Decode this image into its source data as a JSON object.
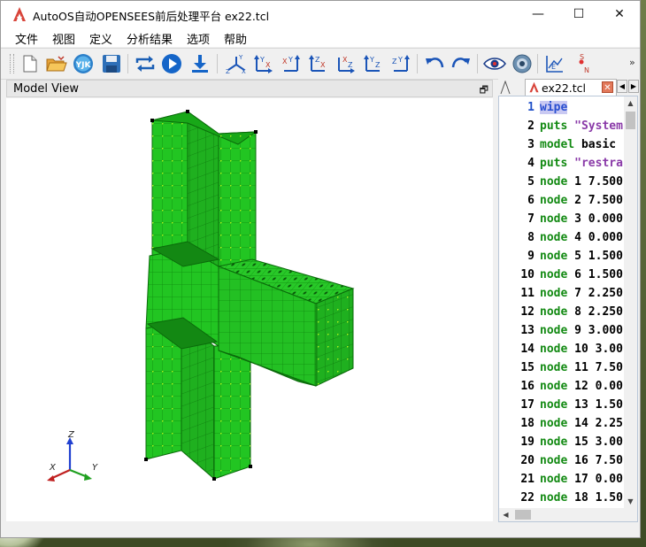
{
  "window": {
    "title": "AutoOS自动OPENSEES前后处理平台 ex22.tcl",
    "minimize": "—",
    "maximize": "☐",
    "close": "✕"
  },
  "menu": [
    "文件",
    "视图",
    "定义",
    "分析结果",
    "选项",
    "帮助"
  ],
  "toolbar": {
    "buttons": [
      "new-file-icon",
      "open-folder-icon",
      "yjk-import-icon",
      "save-icon",
      "refresh-icon",
      "run-icon",
      "download-icon",
      "view-3d-icon",
      "view-xy-icon",
      "view-yx-icon",
      "view-xz-icon",
      "view-zx-icon",
      "view-yz-icon",
      "view-zy-icon",
      "undo-icon",
      "redo-icon",
      "eye-icon",
      "camera-icon",
      "edit-chart-icon",
      "section-sn-icon"
    ],
    "yjk_label": "YJK",
    "more": "»"
  },
  "model_view": {
    "title": "Model View",
    "restore": "🗗",
    "axes": {
      "z": "Z",
      "x": "X",
      "y": "Y"
    }
  },
  "editor": {
    "tab_label": "ex22.tcl",
    "close": "✕",
    "nav_left": "◀",
    "nav_right": "▶",
    "lines": [
      {
        "n": "1",
        "kw": "wipe",
        "rest": ""
      },
      {
        "n": "2",
        "kw": "puts",
        "rest": " \"System"
      },
      {
        "n": "3",
        "kw": "model",
        "rest": " basic"
      },
      {
        "n": "4",
        "kw": "puts",
        "rest": " \"restra"
      },
      {
        "n": "5",
        "kw": "node",
        "rest": " 1 7.500"
      },
      {
        "n": "6",
        "kw": "node",
        "rest": " 2 7.500"
      },
      {
        "n": "7",
        "kw": "node",
        "rest": " 3 0.000"
      },
      {
        "n": "8",
        "kw": "node",
        "rest": " 4 0.000"
      },
      {
        "n": "9",
        "kw": "node",
        "rest": " 5 1.500"
      },
      {
        "n": "10",
        "kw": "node",
        "rest": " 6 1.500"
      },
      {
        "n": "11",
        "kw": "node",
        "rest": " 7 2.250"
      },
      {
        "n": "12",
        "kw": "node",
        "rest": " 8 2.250"
      },
      {
        "n": "13",
        "kw": "node",
        "rest": " 9 3.000"
      },
      {
        "n": "14",
        "kw": "node",
        "rest": " 10 3.00"
      },
      {
        "n": "15",
        "kw": "node",
        "rest": " 11 7.50"
      },
      {
        "n": "16",
        "kw": "node",
        "rest": " 12 0.00"
      },
      {
        "n": "17",
        "kw": "node",
        "rest": " 13 1.50"
      },
      {
        "n": "18",
        "kw": "node",
        "rest": " 14 2.25"
      },
      {
        "n": "19",
        "kw": "node",
        "rest": " 15 3.00"
      },
      {
        "n": "20",
        "kw": "node",
        "rest": " 16 7.50"
      },
      {
        "n": "21",
        "kw": "node",
        "rest": " 17 0.00"
      },
      {
        "n": "22",
        "kw": "node",
        "rest": " 18 1.50"
      }
    ]
  },
  "colors": {
    "shell_green": "#1fc21f",
    "shell_dark": "#0a7a0a",
    "node_dot": "#a6f01e",
    "keyword_green": "#138a13",
    "string_purple": "#8a3aa8"
  }
}
